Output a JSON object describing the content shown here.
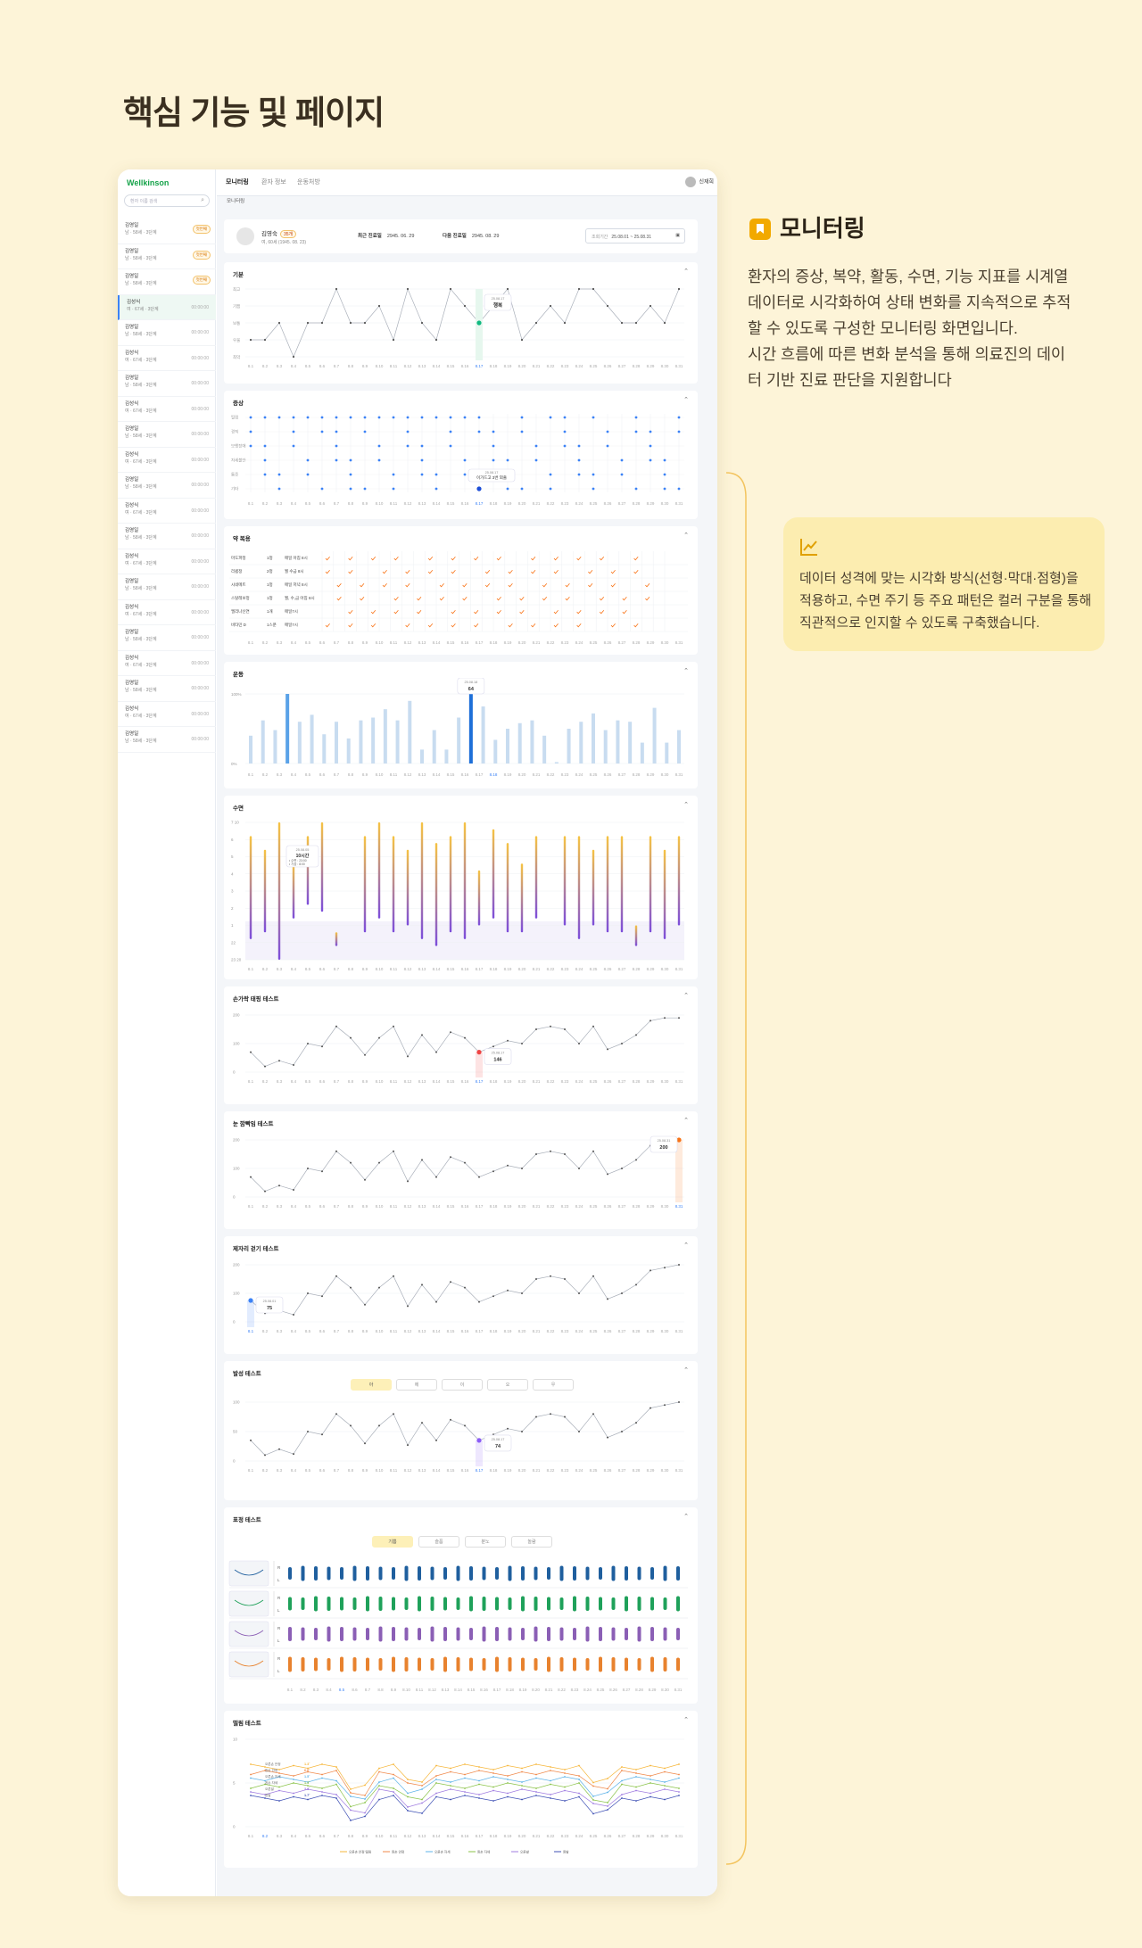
{
  "page_heading": "핵심 기능 및 페이지",
  "app": {
    "logo": "Wellkinson",
    "search_placeholder": "환자 이름 검색",
    "tabs": [
      "모니터링",
      "환자 정보",
      "운동처방"
    ],
    "user_name": "신재희",
    "breadcrumb": "모니터링",
    "patients": [
      {
        "name": "김영일",
        "sub": "남 · 58세 · 3단계",
        "time": "",
        "badge": "첫번째"
      },
      {
        "name": "김영일",
        "sub": "남 · 58세 · 3단계",
        "time": "",
        "badge": "첫번째"
      },
      {
        "name": "김영일",
        "sub": "남 · 58세 · 3단계",
        "time": "",
        "badge": "첫번째"
      },
      {
        "name": "김성식",
        "sub": "여 · 67세 · 3단계",
        "time": "00:00:00",
        "badge": ""
      },
      {
        "name": "김영일",
        "sub": "남 · 58세 · 3단계",
        "time": "00:00:00",
        "badge": ""
      },
      {
        "name": "김성식",
        "sub": "여 · 67세 · 3단계",
        "time": "00:00:00",
        "badge": ""
      },
      {
        "name": "김영일",
        "sub": "남 · 58세 · 3단계",
        "time": "00:00:00",
        "badge": ""
      },
      {
        "name": "김성식",
        "sub": "여 · 67세 · 3단계",
        "time": "00:00:00",
        "badge": ""
      },
      {
        "name": "김영일",
        "sub": "남 · 58세 · 3단계",
        "time": "00:00:00",
        "badge": ""
      },
      {
        "name": "김성식",
        "sub": "여 · 67세 · 3단계",
        "time": "00:00:00",
        "badge": ""
      },
      {
        "name": "김영일",
        "sub": "남 · 58세 · 3단계",
        "time": "00:00:00",
        "badge": ""
      },
      {
        "name": "김성식",
        "sub": "여 · 67세 · 3단계",
        "time": "00:00:00",
        "badge": ""
      },
      {
        "name": "김영일",
        "sub": "남 · 58세 · 3단계",
        "time": "00:00:00",
        "badge": ""
      },
      {
        "name": "김성식",
        "sub": "여 · 67세 · 3단계",
        "time": "00:00:00",
        "badge": ""
      },
      {
        "name": "김영일",
        "sub": "남 · 58세 · 3단계",
        "time": "00:00:00",
        "badge": ""
      },
      {
        "name": "김성식",
        "sub": "여 · 67세 · 3단계",
        "time": "00:00:00",
        "badge": ""
      },
      {
        "name": "김영일",
        "sub": "남 · 58세 · 3단계",
        "time": "00:00:00",
        "badge": ""
      },
      {
        "name": "김성식",
        "sub": "여 · 67세 · 3단계",
        "time": "00:00:00",
        "badge": ""
      },
      {
        "name": "김영일",
        "sub": "남 · 58세 · 3단계",
        "time": "00:00:00",
        "badge": ""
      },
      {
        "name": "김성식",
        "sub": "여 · 67세 · 3단계",
        "time": "00:00:00",
        "badge": ""
      },
      {
        "name": "김영일",
        "sub": "남 · 58세 · 3단계",
        "time": "00:00:00",
        "badge": ""
      }
    ],
    "patient_card": {
      "name": "김영숙",
      "age_badge": "35개",
      "sub": "여, 60세 (1945. 08. 23)",
      "first_visit_label": "최근 진료일",
      "first_visit": "2945. 06. 29",
      "next_visit_label": "다음 진료일",
      "next_visit": "2945. 08. 29",
      "period_label": "조회기간",
      "period": "25.08.01 ~ 25.08.31"
    },
    "cards": {
      "mood": "기분",
      "symptom": "증상",
      "medication": "약 복용",
      "exercise": "운동",
      "sleep": "수면",
      "finger_tapping": "손가락 태핑 테스트",
      "eye_blink": "눈 깜빡임 테스트",
      "sit_stand": "제자리 걷기 테스트",
      "voice": "발성 테스트",
      "face": "표정 테스트",
      "tremor": "떨림 테스트"
    },
    "x_dates": [
      "8.1",
      "8.2",
      "8.3",
      "8.4",
      "8.5",
      "8.6",
      "8.7",
      "8.8",
      "8.9",
      "8.10",
      "8.11",
      "8.12",
      "8.13",
      "8.14",
      "8.15",
      "8.16",
      "8.17",
      "8.18",
      "8.19",
      "8.20",
      "8.21",
      "8.22",
      "8.23",
      "8.24",
      "8.25",
      "8.26",
      "8.27",
      "8.28",
      "8.29",
      "8.30",
      "8.31"
    ],
    "mood_levels": [
      "최고",
      "기쁨",
      "보통",
      "우울",
      "최악"
    ],
    "symptom_rows": [
      "떨림",
      "경직",
      "보행장애",
      "자세불안",
      "통증",
      "기타"
    ],
    "medications": [
      {
        "name": "마도파정",
        "qty": "1정",
        "time": "매일 아침 8시"
      },
      {
        "name": "리큅정",
        "qty": "2정",
        "time": "월 수금 8시"
      },
      {
        "name": "시네메트",
        "qty": "1정",
        "time": "매일 저녁 8시"
      },
      {
        "name": "스탈레보정",
        "qty": "1정",
        "time": "월, 수,금 아침 8시"
      },
      {
        "name": "엘리나신연",
        "qty": "1개",
        "time": "매일7시"
      },
      {
        "name": "비타민 D",
        "qty": "1스푼",
        "time": "매일7시"
      }
    ],
    "voice_tabs": [
      "아",
      "에",
      "이",
      "오",
      "우"
    ],
    "face_tabs": [
      "기쁨",
      "슬픔",
      "분노",
      "놀람"
    ],
    "face_side_labels": [
      "R",
      "L"
    ],
    "tremor_row_labels": [
      "오른손 안정",
      "왼손 안정",
      "오른손 자세",
      "왼손 자세",
      "오른발",
      "왼발"
    ],
    "tremor_values": [
      "1.3˚",
      "6.6˚",
      "1.5˚",
      "1.3˚",
      "3.3˚",
      "1.7˚"
    ],
    "tremor_legend": [
      "오른손 안정 떨림",
      "왼손 안정",
      "오른손 자세",
      "왼손 자세",
      "오른발",
      "왼발"
    ]
  },
  "chart_data": [
    {
      "type": "line",
      "title": "기분",
      "tooltip": {
        "date": "25.08.17",
        "value": "행복"
      },
      "y_labels": [
        "최고",
        "기쁨",
        "보통",
        "우울",
        "최악"
      ],
      "values": [
        2,
        2,
        3,
        1,
        3,
        3,
        5,
        3,
        3,
        4,
        2,
        5,
        3,
        2,
        5,
        4,
        3,
        4,
        5,
        2,
        3,
        4,
        3,
        5,
        5,
        4,
        3,
        3,
        4,
        3,
        5
      ]
    },
    {
      "type": "scatter",
      "title": "증상",
      "tooltip": {
        "date": "25.08.17",
        "value": "이가드고 3번 외출"
      }
    },
    {
      "type": "table",
      "title": "약 복용"
    },
    {
      "type": "bar",
      "title": "운동",
      "y_labels": [
        "100%",
        "0%"
      ],
      "tooltip": {
        "date": "25.08.18",
        "value": "64"
      },
      "values": [
        40,
        62,
        48,
        100,
        60,
        70,
        42,
        60,
        36,
        62,
        66,
        78,
        62,
        90,
        20,
        48,
        20,
        66,
        100,
        82,
        34,
        50,
        58,
        62,
        40,
        2,
        50,
        60,
        72,
        48,
        62,
        60,
        30,
        80,
        30,
        48
      ]
    },
    {
      "type": "bar",
      "title": "수면",
      "y_labels": [
        "7 10",
        "6",
        "5",
        "4",
        "3",
        "2",
        "1",
        "22",
        "23 20"
      ],
      "tooltip": {
        "date": "25.08.05",
        "value": "10시간",
        "rows": [
          "• 수면 : 23:00",
          "• 기상 : 8:00"
        ]
      }
    },
    {
      "type": "line",
      "title": "손가락 태핑 테스트",
      "y_labels": [
        "200",
        "100",
        "0"
      ],
      "tooltip": {
        "date": "25.08.17",
        "value": "146"
      },
      "values": [
        70,
        20,
        40,
        25,
        100,
        90,
        160,
        120,
        60,
        120,
        160,
        55,
        130,
        70,
        140,
        120,
        70,
        90,
        110,
        100,
        150,
        160,
        150,
        100,
        160,
        80,
        100,
        130,
        180,
        190,
        190
      ]
    },
    {
      "type": "line",
      "title": "눈 깜빡임 테스트",
      "y_labels": [
        "200",
        "100",
        "0"
      ],
      "tooltip": {
        "date": "25.08.31",
        "value": "200"
      },
      "values": [
        70,
        20,
        40,
        25,
        100,
        90,
        160,
        120,
        60,
        120,
        160,
        55,
        130,
        70,
        140,
        120,
        70,
        90,
        110,
        100,
        150,
        160,
        150,
        100,
        160,
        80,
        100,
        130,
        180,
        190,
        200
      ]
    },
    {
      "type": "line",
      "title": "제자리 걷기 테스트",
      "y_labels": [
        "200",
        "100",
        "0"
      ],
      "tooltip": {
        "date": "25.08.01",
        "value": "75"
      },
      "values": [
        75,
        30,
        40,
        25,
        100,
        90,
        160,
        120,
        60,
        120,
        160,
        55,
        130,
        70,
        140,
        120,
        70,
        90,
        110,
        100,
        150,
        160,
        150,
        100,
        160,
        80,
        100,
        130,
        180,
        190,
        200
      ]
    },
    {
      "type": "line",
      "title": "발성 테스트",
      "y_labels": [
        "100",
        "50",
        "0"
      ],
      "tooltip": {
        "date": "25.08.17",
        "value": "74"
      },
      "values": [
        35,
        10,
        20,
        12,
        50,
        45,
        80,
        60,
        30,
        60,
        80,
        27,
        65,
        35,
        70,
        60,
        35,
        45,
        55,
        50,
        75,
        80,
        75,
        50,
        80,
        40,
        50,
        65,
        90,
        95,
        100
      ]
    },
    {
      "type": "bar",
      "title": "표정 테스트"
    },
    {
      "type": "line",
      "title": "떨림 테스트",
      "y_labels": [
        "10",
        "5",
        "0"
      ]
    }
  ]
}
